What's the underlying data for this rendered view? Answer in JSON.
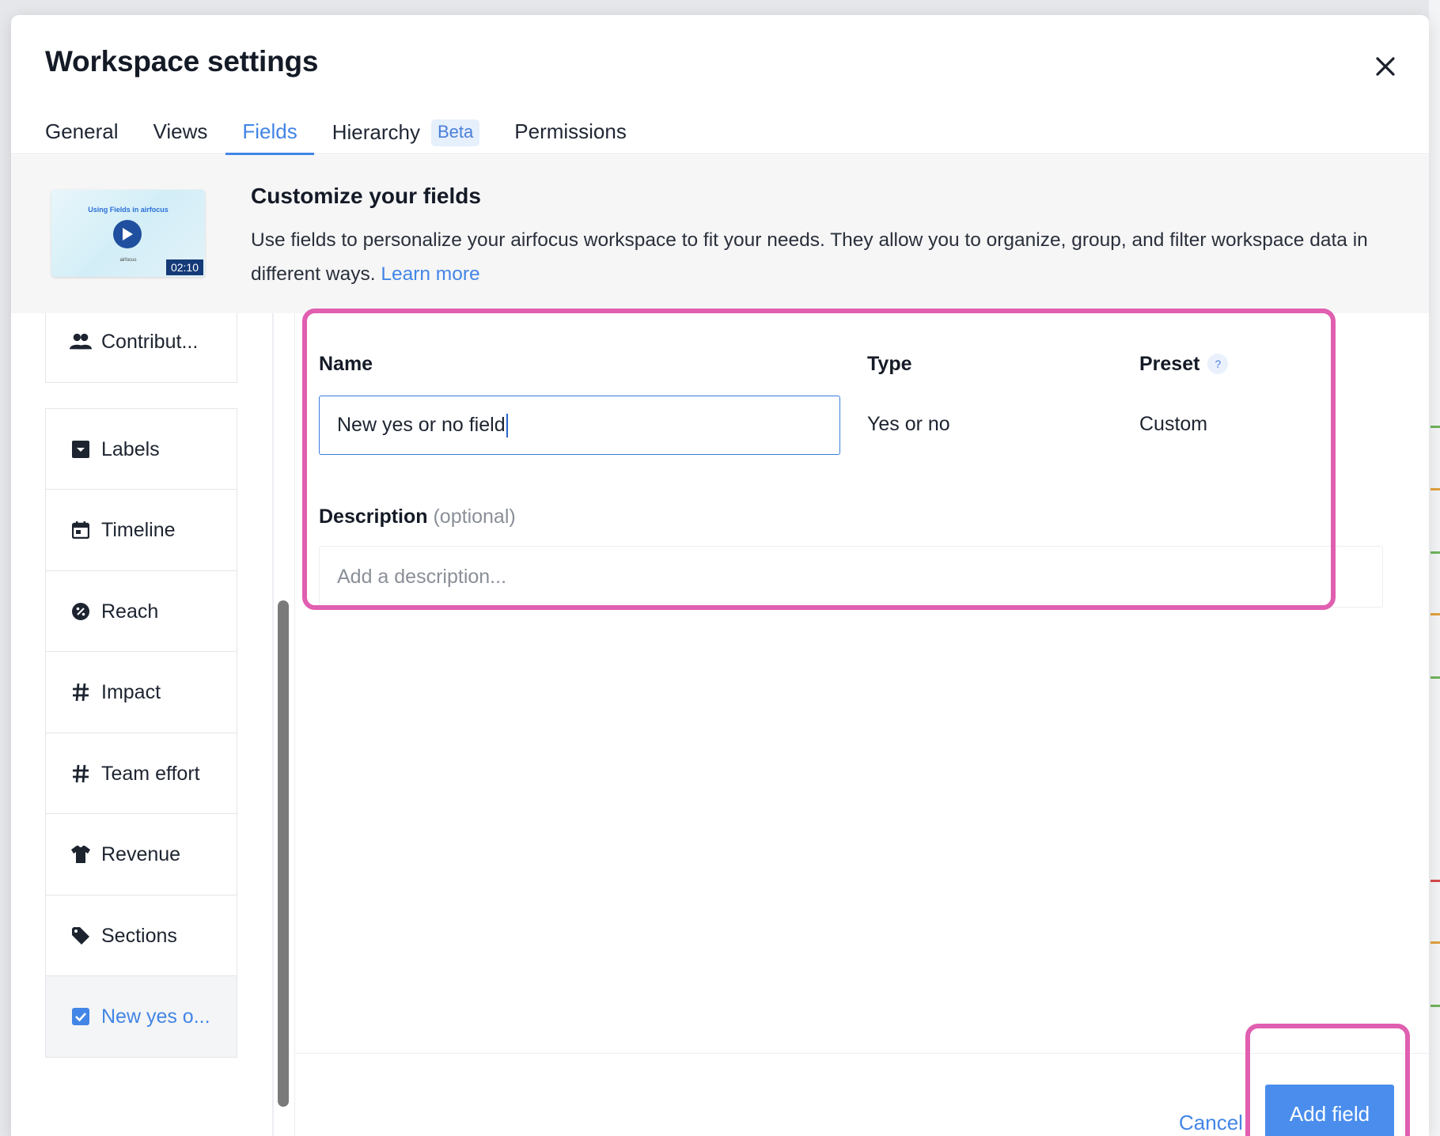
{
  "modal": {
    "title": "Workspace settings",
    "tabs": [
      {
        "label": "General"
      },
      {
        "label": "Views"
      },
      {
        "label": "Fields",
        "active": true
      },
      {
        "label": "Hierarchy",
        "badge": "Beta"
      },
      {
        "label": "Permissions"
      }
    ]
  },
  "intro": {
    "video_title": "Using Fields in airfocus",
    "video_brand": "airfocus",
    "video_duration": "02:10",
    "title": "Customize your fields",
    "text": "Use fields to personalize your airfocus workspace to fit your needs. They allow you to organize, group, and filter workspace data in different ways.",
    "link": "Learn more"
  },
  "fields": [
    {
      "label": "Contribut...",
      "icon": "people-icon"
    },
    {
      "label": "Labels",
      "icon": "dropdown-icon"
    },
    {
      "label": "Timeline",
      "icon": "calendar-icon"
    },
    {
      "label": "Reach",
      "icon": "percent-icon"
    },
    {
      "label": "Impact",
      "icon": "hash-icon"
    },
    {
      "label": "Team effort",
      "icon": "hash-icon"
    },
    {
      "label": "Revenue",
      "icon": "shirt-icon"
    },
    {
      "label": "Sections",
      "icon": "tag-icon"
    },
    {
      "label": "New yes o...",
      "icon": "checkbox-icon",
      "active": true
    }
  ],
  "form": {
    "name_label": "Name",
    "name_value": "New yes or no field",
    "type_label": "Type",
    "type_value": "Yes or no",
    "preset_label": "Preset",
    "preset_help": "?",
    "preset_value": "Custom",
    "description_label": "Description",
    "description_optional": "(optional)",
    "description_placeholder": "Add a description..."
  },
  "footer": {
    "cancel_label": "Cancel",
    "add_label": "Add field"
  },
  "colors": {
    "accent": "#4285e6",
    "highlight": "#e05fb0"
  }
}
